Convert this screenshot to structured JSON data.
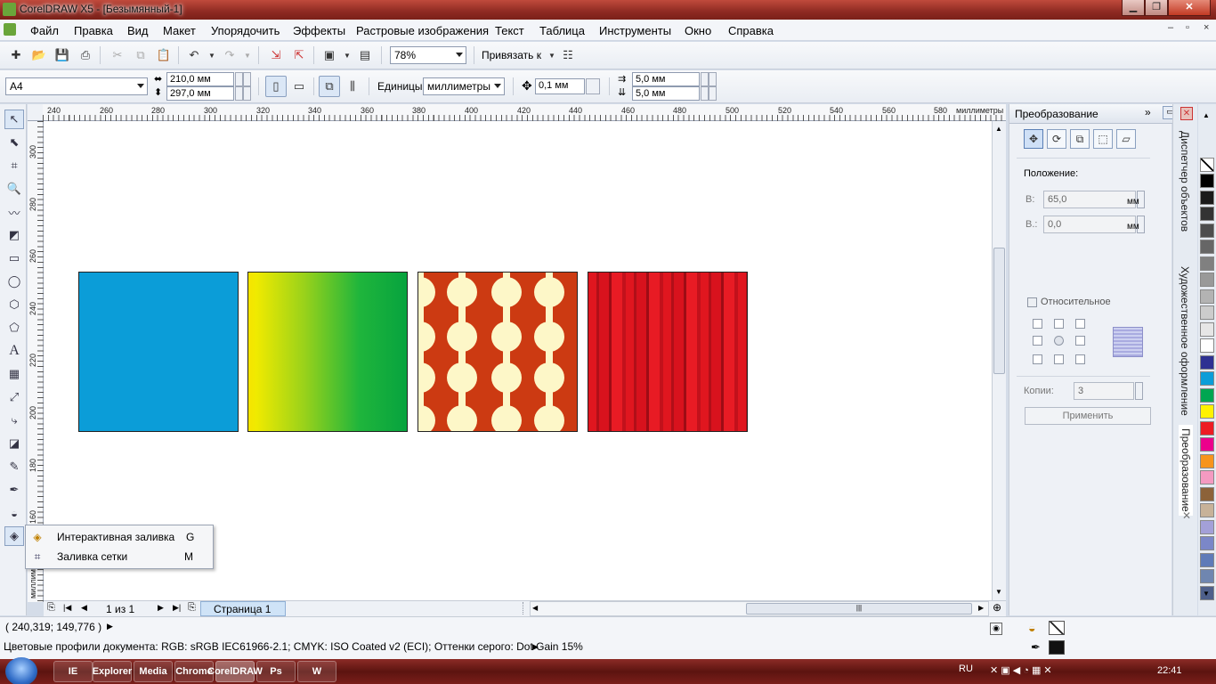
{
  "window": {
    "title": "CorelDRAW X5 - [Безымянный-1]",
    "min_label": "▁",
    "max_label": "❐",
    "close_label": "✕"
  },
  "menu": {
    "items": [
      "Файл",
      "Правка",
      "Вид",
      "Макет",
      "Упорядочить",
      "Эффекты",
      "Растровые изображения",
      "Текст",
      "Таблица",
      "Инструменты",
      "Окно",
      "Справка"
    ],
    "doc_min": "–",
    "doc_restore": "▫",
    "doc_close": "×"
  },
  "toolbar": {
    "zoom": "78%",
    "snap_label": "Привязать к"
  },
  "propbar": {
    "page_size": "A4",
    "width": "210,0 мм",
    "height": "297,0 мм",
    "units_label": "Единицы:",
    "units_value": "миллиметры",
    "nudge": "0,1 мм",
    "dup_x": "5,0 мм",
    "dup_y": "5,0 мм"
  },
  "ruler": {
    "h_labels": [
      "240",
      "260",
      "280",
      "300",
      "320",
      "340",
      "360",
      "380",
      "400",
      "420",
      "440",
      "460",
      "480",
      "500",
      "520",
      "540",
      "560",
      "580"
    ],
    "h_unit": "миллиметры",
    "v_labels": [
      "300",
      "280",
      "260",
      "240",
      "220",
      "200",
      "180",
      "160"
    ],
    "v_unit": "миллиметры"
  },
  "canvas": {
    "objects": [
      {
        "name": "blue-square",
        "fill": "uniform",
        "color": "#0b9dd8"
      },
      {
        "name": "gradient-square",
        "fill": "fountain",
        "colors": [
          "#f5e400",
          "#1fb53c",
          "#07a33e"
        ]
      },
      {
        "name": "dots-pattern-square",
        "fill": "pattern",
        "colors": [
          "#cc3a12",
          "#fdf7c8"
        ]
      },
      {
        "name": "curtain-texture-square",
        "fill": "texture",
        "colors": [
          "#d9141f",
          "#a80e18"
        ]
      }
    ]
  },
  "flyout": {
    "items": [
      {
        "label": "Интерактивная заливка",
        "key": "G"
      },
      {
        "label": "Заливка сетки",
        "key": "M"
      }
    ]
  },
  "pagenav": {
    "counter": "1 из 1",
    "page_tab": "Страница 1"
  },
  "docker": {
    "title": "Преобразование",
    "position_label": "Положение:",
    "h_label": "В:",
    "h_value": "65,0",
    "v_label": "В.:",
    "v_value": "0,0",
    "unit": "мм",
    "relative_label": "Относительное",
    "copies_label": "Копии:",
    "copies_value": "3",
    "apply_label": "Применить"
  },
  "side_tabs": [
    "Диспетчер объектов",
    "Художественное оформление",
    "Преобразование"
  ],
  "palette": [
    "#ffffff",
    "#000000",
    "#1a1a1a",
    "#333333",
    "#4d4d4d",
    "#666666",
    "#808080",
    "#999999",
    "#b3b3b3",
    "#cccccc",
    "#e6e6e6",
    "#ffffff",
    "#2e3192",
    "#0b9dd8",
    "#00a651",
    "#fff200",
    "#ed1c24",
    "#ec008c",
    "#f7941d",
    "#f49ac1",
    "#8c6239",
    "#c7b299",
    "#a3a0d8",
    "#7b87c8",
    "#5f7bb8",
    "#6f86b0",
    "#4e5f8a"
  ],
  "status": {
    "coords": "( 240,319; 149,776 )",
    "profile": "Цветовые профили документа: RGB: sRGB IEC61966-2.1; CMYK: ISO Coated v2 (ECI); Оттенки серого: Dot Gain 15%"
  },
  "taskbar": {
    "lang": "RU",
    "time": "22:41",
    "apps": [
      "IE",
      "Explorer",
      "Media",
      "Chrome",
      "CorelDRAW",
      "Ps",
      "W"
    ]
  }
}
